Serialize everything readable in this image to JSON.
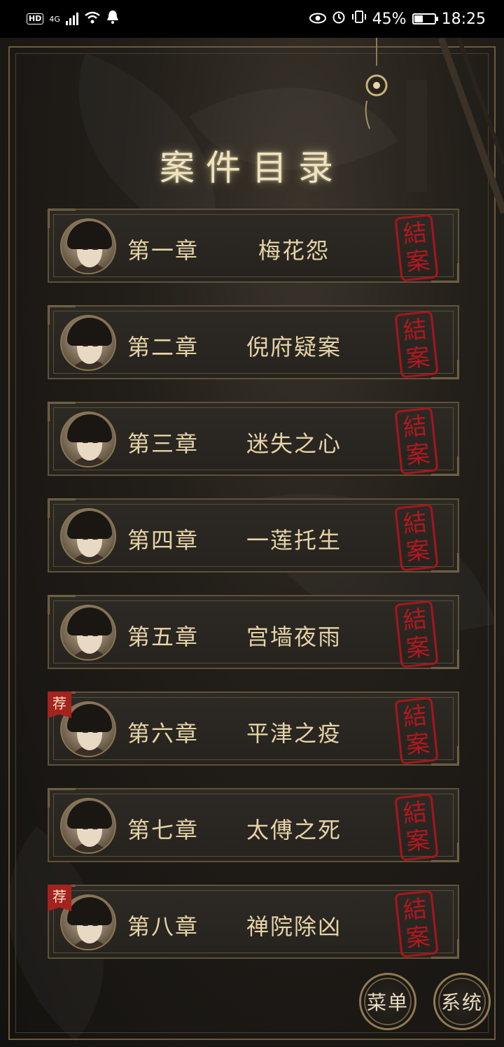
{
  "status_bar": {
    "network": "4G",
    "battery": "45%",
    "battery_level": 0.45,
    "time": "18:25"
  },
  "title": "案件目录",
  "chapters": [
    {
      "num": "第一章",
      "name": "梅花怨",
      "seal": [
        "結",
        "案"
      ],
      "recommended": false
    },
    {
      "num": "第二章",
      "name": "倪府疑案",
      "seal": [
        "結",
        "案"
      ],
      "recommended": false
    },
    {
      "num": "第三章",
      "name": "迷失之心",
      "seal": [
        "結",
        "案"
      ],
      "recommended": false
    },
    {
      "num": "第四章",
      "name": "一莲托生",
      "seal": [
        "結",
        "案"
      ],
      "recommended": false
    },
    {
      "num": "第五章",
      "name": "宫墙夜雨",
      "seal": [
        "結",
        "案"
      ],
      "recommended": false
    },
    {
      "num": "第六章",
      "name": "平津之疫",
      "seal": [
        "結",
        "案"
      ],
      "recommended": true
    },
    {
      "num": "第七章",
      "name": "太傅之死",
      "seal": [
        "結",
        "案"
      ],
      "recommended": false
    },
    {
      "num": "第八章",
      "name": "禅院除凶",
      "seal": [
        "結",
        "案"
      ],
      "recommended": true
    }
  ],
  "recommend_badge": "荐",
  "buttons": {
    "menu": "菜单",
    "system": "系统"
  }
}
